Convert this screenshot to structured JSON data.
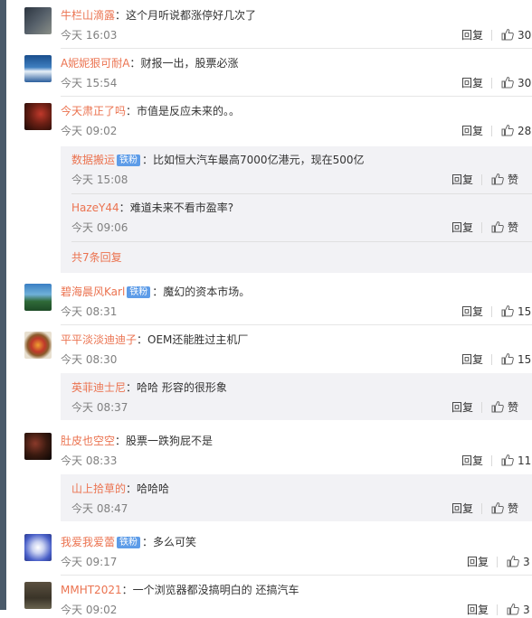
{
  "labels": {
    "reply": "回复",
    "like": "赞",
    "badge": "铁粉"
  },
  "colors": {
    "username": "#eb7350",
    "timestamp": "#808080",
    "badge": "#5d9ce8",
    "sub_bg": "#f2f2f5"
  },
  "comments": [
    {
      "user": "牛栏山滴露",
      "text": "这个月听说都涨停好几次了",
      "time": "今天 16:03",
      "likes": "30"
    },
    {
      "user": "A妮妮狠可耐A",
      "text": "财报一出，股票必涨",
      "time": "今天 15:54",
      "likes": "30"
    },
    {
      "user": "今天肃正了吗",
      "text": "市值是反应未来的。。",
      "time": "今天 09:02",
      "likes": "28",
      "replies": [
        {
          "user": "数据搬运",
          "text": "比如恒大汽车最高7000亿港元，现在500亿",
          "time": "今天 15:08"
        },
        {
          "user": "HazeY44",
          "text": "难道未来不看市盈率?",
          "time": "今天 09:06"
        }
      ],
      "more": "共7条回复"
    },
    {
      "user": "碧海晨风Karl",
      "text": "魔幻的资本市场。",
      "time": "今天 08:31",
      "likes": "15"
    },
    {
      "user": "平平淡淡迪迪子",
      "text": "OEM还能胜过主机厂",
      "time": "今天 08:30",
      "likes": "15",
      "replies": [
        {
          "user": "英菲迪士尼",
          "text": "哈哈 形容的很形象",
          "time": "今天 08:37"
        }
      ]
    },
    {
      "user": "肚皮也空空",
      "text": "股票一跌狗屁不是",
      "time": "今天 08:33",
      "likes": "11",
      "replies": [
        {
          "user": "山上拾草的",
          "text": "哈哈哈",
          "time": "今天 08:47"
        }
      ]
    },
    {
      "user": "我爱我爱蕾",
      "text": "多么可笑",
      "time": "今天 09:17",
      "likes": "3"
    },
    {
      "user": "MMHT2021",
      "text": "一个浏览器都没搞明白的 还搞汽车",
      "time": "今天 09:02",
      "likes": "3"
    }
  ]
}
